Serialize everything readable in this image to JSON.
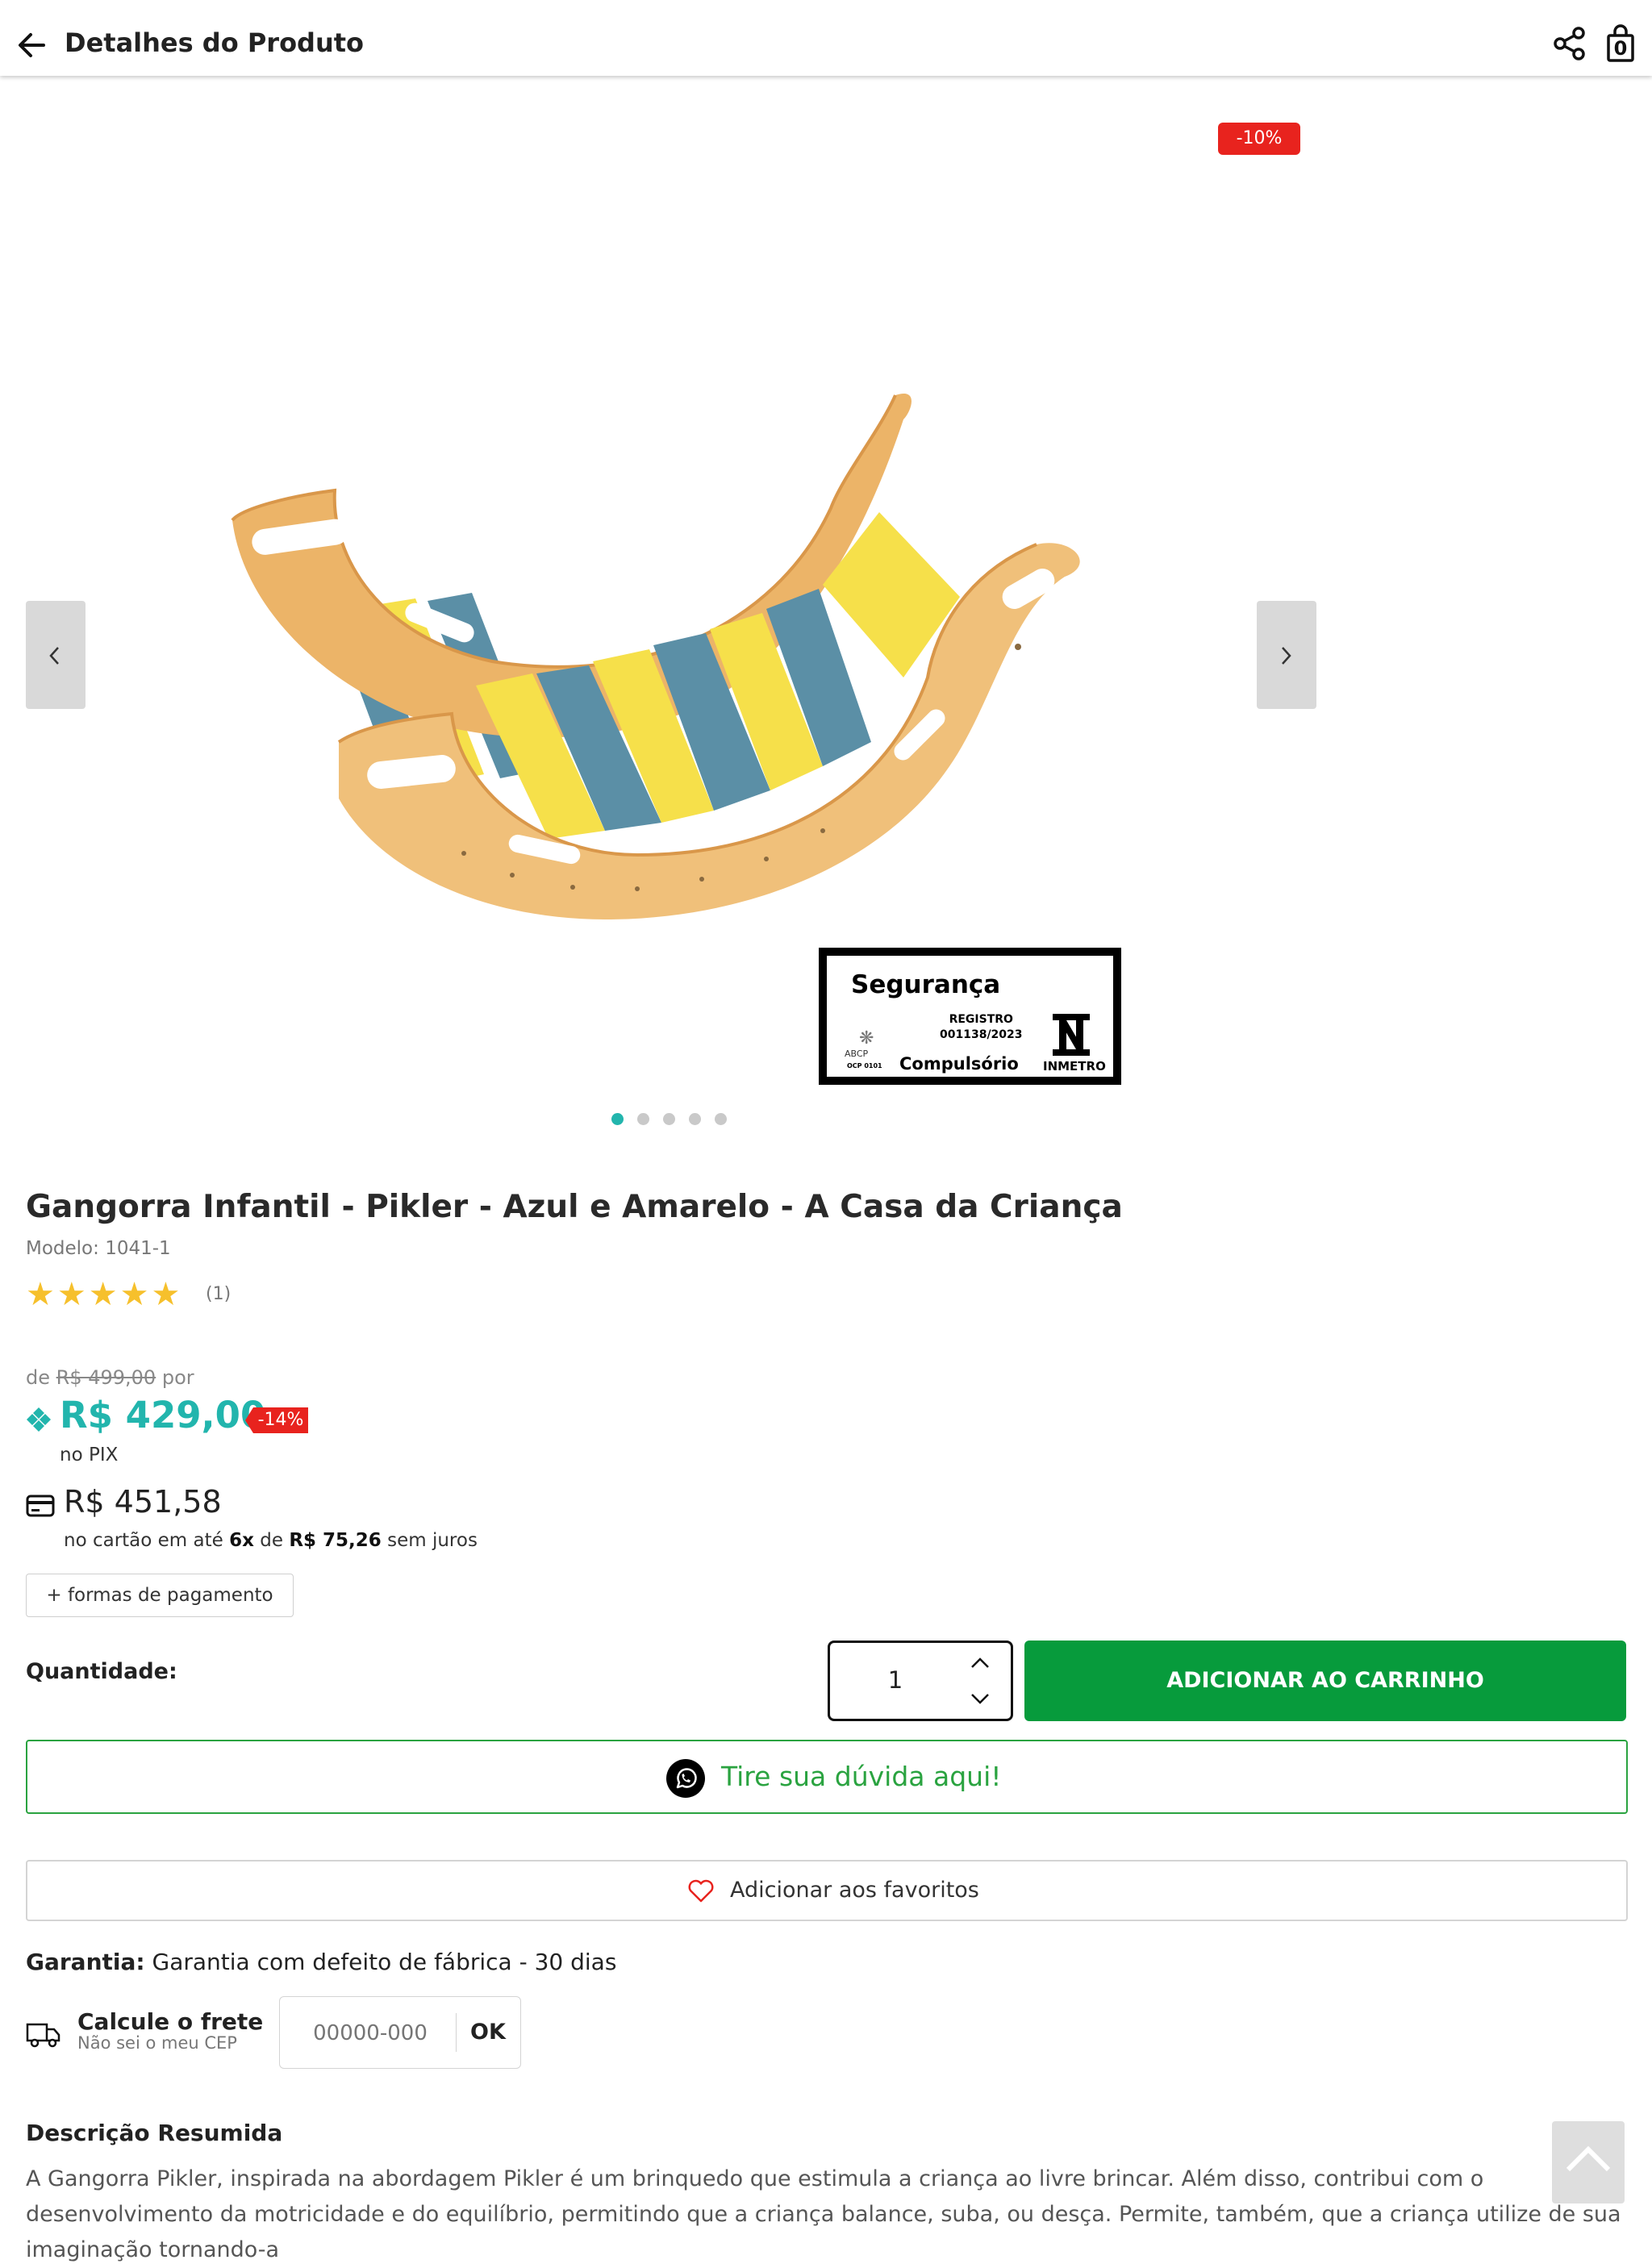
{
  "header": {
    "title": "Detalhes do Produto",
    "bag_count": "0"
  },
  "gallery": {
    "discount_badge": "-10%",
    "seal": {
      "title": "Segurança",
      "registro_label": "REGISTRO",
      "registro_number": "001138/2023",
      "compulsorio": "Compulsório",
      "abcp": "ABCP",
      "ocp": "OCP 0101",
      "inmetro": "INMETRO"
    },
    "slides_total": 5,
    "active_slide": 1,
    "product_colors": {
      "wood": "#f0c07a",
      "yellow": "#f6e04a",
      "blue": "#5b8fa6"
    }
  },
  "product": {
    "title": "Gangorra Infantil - Pikler - Azul e Amarelo - A Casa da Criança",
    "model": "Modelo: 1041-1",
    "rating_stars": 5,
    "rating_count": "(1)",
    "price_from_prefix": "de",
    "price_old": "R$ 499,00",
    "price_from_suffix": "por",
    "pix_price": "R$ 429,00",
    "pix_discount": "-14%",
    "pix_label": "no PIX",
    "card_price": "R$ 451,58",
    "installment_prefix": "no cartão em até",
    "installment_count": "6x",
    "installment_mid": "de",
    "installment_value": "R$ 75,26",
    "installment_suffix": "sem juros",
    "payment_options": "+ formas de pagamento"
  },
  "purchase": {
    "quantity_label": "Quantidade:",
    "quantity_value": "1",
    "add_to_cart": "ADICIONAR AO CARRINHO",
    "whatsapp": "Tire sua dúvida aqui!",
    "favorites": "Adicionar aos favoritos"
  },
  "warranty": {
    "label": "Garantia:",
    "text": "Garantia com defeito de fábrica - 30 dias"
  },
  "shipping": {
    "title": "Calcule o frete",
    "subtitle": "Não sei o meu CEP",
    "placeholder": "00000-000",
    "ok": "OK"
  },
  "description": {
    "title": "Descrição Resumida",
    "text": "A Gangorra Pikler, inspirada na abordagem Pikler é um brinquedo que estimula a criança ao livre brincar. Além disso, contribui com o desenvolvimento da motricidade e do equilíbrio, permitindo que a criança balance, suba, ou desça. Permite, também, que a criança utilize de sua imaginação tornando-a"
  },
  "colors": {
    "accent_teal": "#22b5ad",
    "cart_green": "#079b3c",
    "whatsapp_green": "#2aa340",
    "discount_red": "#e8231e",
    "star_yellow": "#f6c02c"
  }
}
